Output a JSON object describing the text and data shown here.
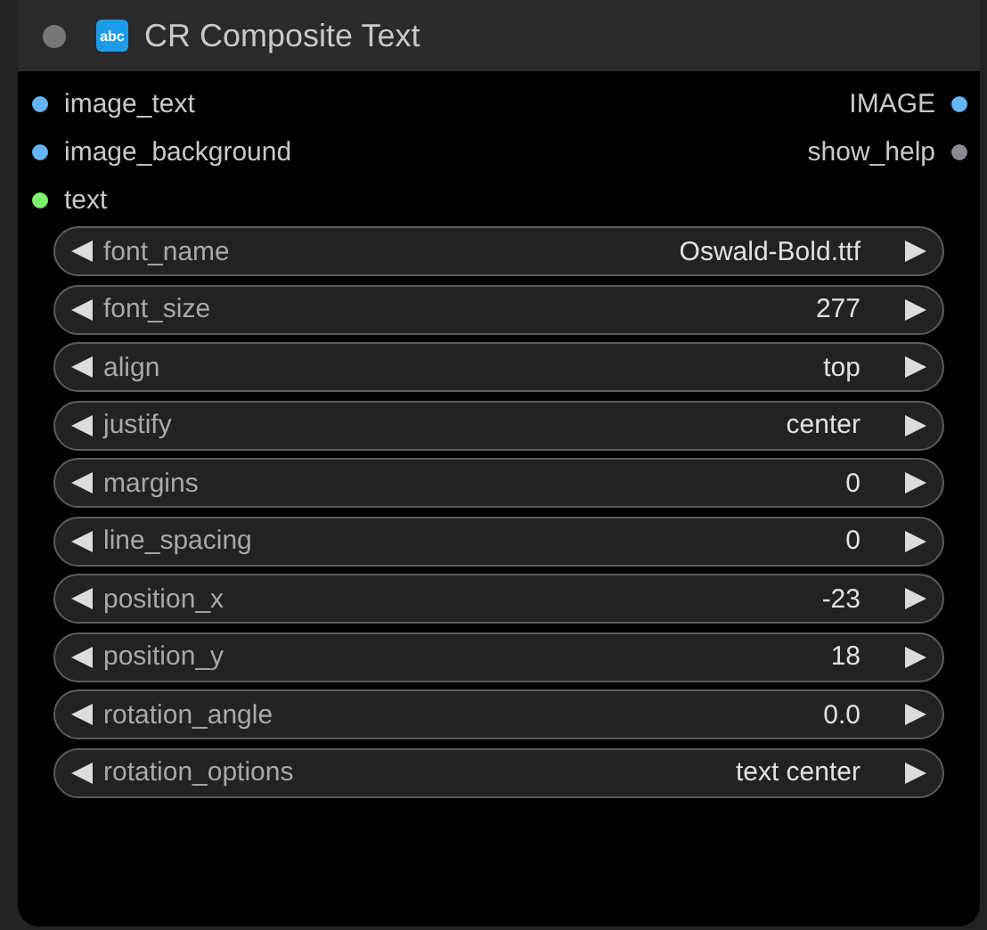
{
  "node": {
    "title": "CR Composite Text",
    "icon_text": "abc",
    "inputs": [
      {
        "name": "image_text",
        "color": "#64b5f6"
      },
      {
        "name": "image_background",
        "color": "#64b5f6"
      },
      {
        "name": "text",
        "color": "#7cf26c"
      }
    ],
    "outputs": [
      {
        "name": "IMAGE",
        "color": "#64b5f6"
      },
      {
        "name": "show_help",
        "color": "#8a8a94"
      }
    ],
    "widgets": [
      {
        "label": "font_name",
        "value": "Oswald-Bold.ttf"
      },
      {
        "label": "font_size",
        "value": "277"
      },
      {
        "label": "align",
        "value": "top"
      },
      {
        "label": "justify",
        "value": "center"
      },
      {
        "label": "margins",
        "value": "0"
      },
      {
        "label": "line_spacing",
        "value": "0"
      },
      {
        "label": "position_x",
        "value": "-23"
      },
      {
        "label": "position_y",
        "value": "18"
      },
      {
        "label": "rotation_angle",
        "value": "0.0"
      },
      {
        "label": "rotation_options",
        "value": "text center"
      }
    ]
  }
}
